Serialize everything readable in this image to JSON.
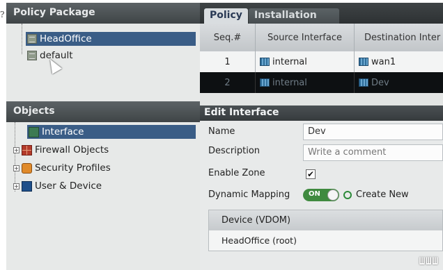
{
  "prefix_char": "?",
  "policy_package": {
    "title": "Policy Package",
    "items": [
      {
        "label": "HeadOffice",
        "selected": true
      },
      {
        "label": "default",
        "selected": false
      }
    ]
  },
  "objects": {
    "title": "Objects",
    "items": [
      {
        "label": "Interface",
        "selected": true,
        "icon": "interface-icon"
      },
      {
        "label": "Firewall Objects",
        "selected": false,
        "icon": "firewall-icon"
      },
      {
        "label": "Security Profiles",
        "selected": false,
        "icon": "security-icon"
      },
      {
        "label": "User & Device",
        "selected": false,
        "icon": "user-icon"
      }
    ]
  },
  "tabs": [
    {
      "label": "Policy",
      "active": true
    },
    {
      "label": "Installation",
      "active": false
    }
  ],
  "policy_table": {
    "columns": [
      "Seq.#",
      "Source Interface",
      "Destination Inter"
    ],
    "rows": [
      {
        "seq": "1",
        "source": "internal",
        "destination": "wan1"
      },
      {
        "seq": "2",
        "source": "internal",
        "destination": "Dev"
      }
    ]
  },
  "edit_interface": {
    "title": "Edit Interface",
    "name_label": "Name",
    "name_value": "Dev",
    "description_label": "Description",
    "description_placeholder": "Write a comment",
    "enable_zone_label": "Enable Zone",
    "enable_zone_check": "✔",
    "dynamic_mapping_label": "Dynamic Mapping",
    "toggle_label": "ON",
    "create_new_label": "Create New",
    "device_table": {
      "header": "Device (VDOM)",
      "rows": [
        "HeadOffice (root)"
      ]
    }
  },
  "watermark": "ШШШ",
  "colors": {
    "selected_bg": "#3a5d86",
    "toggle_on": "#3f8a3f",
    "panel_header": "#4a4f52"
  }
}
